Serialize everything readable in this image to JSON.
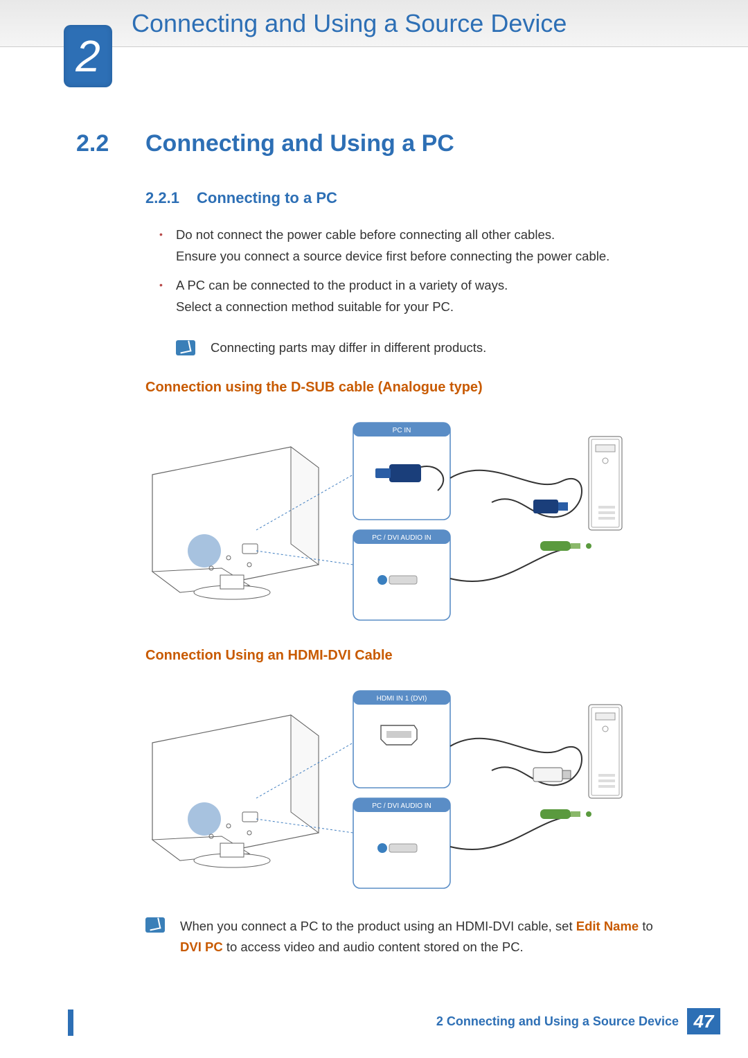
{
  "chapter": {
    "number": "2",
    "title": "Connecting and Using a Source Device"
  },
  "section": {
    "number": "2.2",
    "title": "Connecting and Using a PC"
  },
  "subsection": {
    "number": "2.2.1",
    "title": "Connecting to a PC"
  },
  "bullets": [
    {
      "line1": "Do not connect the power cable before connecting all other cables.",
      "line2": "Ensure you connect a source device first before connecting the power cable."
    },
    {
      "line1": "A PC can be connected to the product in a variety of ways.",
      "line2": "Select a connection method suitable for your PC."
    }
  ],
  "note1": "Connecting parts may differ in different products.",
  "heading_dsub": "Connection using the D-SUB cable (Analogue type)",
  "heading_hdmidvi": "Connection Using an HDMI-DVI Cable",
  "diagram1": {
    "port1": "PC IN",
    "port2": "PC / DVI AUDIO IN"
  },
  "diagram2": {
    "port1": "HDMI IN 1 (DVI)",
    "port2": "PC / DVI AUDIO IN"
  },
  "note2": {
    "pre": "When you connect a PC to the product using an HDMI-DVI cable, set ",
    "hl1": "Edit Name",
    "mid": " to ",
    "hl2": "DVI PC",
    "post": " to access video and audio content stored on the PC."
  },
  "footer": {
    "chapter_ref": "2 Connecting and Using a Source Device",
    "page": "47"
  }
}
